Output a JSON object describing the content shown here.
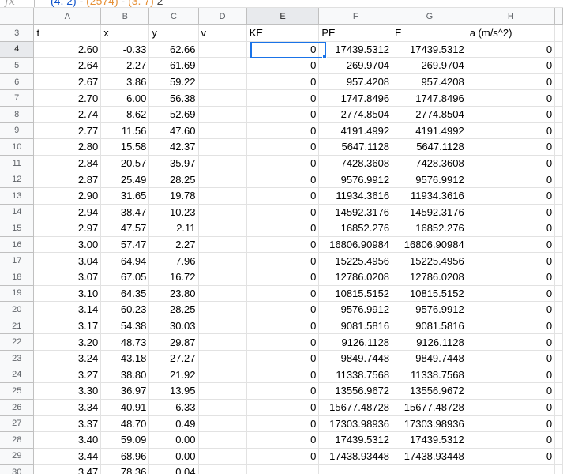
{
  "formula_bar": {
    "fx_label": "fx",
    "formula_part1": "(4. 2)",
    "formula_part2": "(2574)",
    "formula_part3": "(3. 7)",
    "formula_tail": "2"
  },
  "columns": [
    "A",
    "B",
    "C",
    "D",
    "E",
    "F",
    "G",
    "H"
  ],
  "selected_column": "E",
  "selected_row": "4",
  "header_row": {
    "number": "3",
    "cells": [
      "t",
      "x",
      "y",
      "v",
      "KE",
      "PE",
      "E",
      "a (m/s^2)"
    ]
  },
  "rows": [
    {
      "n": "4",
      "c": [
        "2.60",
        "-0.33",
        "62.66",
        "",
        "0",
        "17439.5312",
        "17439.5312",
        "0"
      ]
    },
    {
      "n": "5",
      "c": [
        "2.64",
        "2.27",
        "61.69",
        "",
        "0",
        "269.9704",
        "269.9704",
        "0"
      ]
    },
    {
      "n": "6",
      "c": [
        "2.67",
        "3.86",
        "59.22",
        "",
        "0",
        "957.4208",
        "957.4208",
        "0"
      ]
    },
    {
      "n": "7",
      "c": [
        "2.70",
        "6.00",
        "56.38",
        "",
        "0",
        "1747.8496",
        "1747.8496",
        "0"
      ]
    },
    {
      "n": "8",
      "c": [
        "2.74",
        "8.62",
        "52.69",
        "",
        "0",
        "2774.8504",
        "2774.8504",
        "0"
      ]
    },
    {
      "n": "9",
      "c": [
        "2.77",
        "11.56",
        "47.60",
        "",
        "0",
        "4191.4992",
        "4191.4992",
        "0"
      ]
    },
    {
      "n": "10",
      "c": [
        "2.80",
        "15.58",
        "42.37",
        "",
        "0",
        "5647.1128",
        "5647.1128",
        "0"
      ]
    },
    {
      "n": "11",
      "c": [
        "2.84",
        "20.57",
        "35.97",
        "",
        "0",
        "7428.3608",
        "7428.3608",
        "0"
      ]
    },
    {
      "n": "12",
      "c": [
        "2.87",
        "25.49",
        "28.25",
        "",
        "0",
        "9576.9912",
        "9576.9912",
        "0"
      ]
    },
    {
      "n": "13",
      "c": [
        "2.90",
        "31.65",
        "19.78",
        "",
        "0",
        "11934.3616",
        "11934.3616",
        "0"
      ]
    },
    {
      "n": "14",
      "c": [
        "2.94",
        "38.47",
        "10.23",
        "",
        "0",
        "14592.3176",
        "14592.3176",
        "0"
      ]
    },
    {
      "n": "15",
      "c": [
        "2.97",
        "47.57",
        "2.11",
        "",
        "0",
        "16852.276",
        "16852.276",
        "0"
      ]
    },
    {
      "n": "16",
      "c": [
        "3.00",
        "57.47",
        "2.27",
        "",
        "0",
        "16806.90984",
        "16806.90984",
        "0"
      ]
    },
    {
      "n": "17",
      "c": [
        "3.04",
        "64.94",
        "7.96",
        "",
        "0",
        "15225.4956",
        "15225.4956",
        "0"
      ]
    },
    {
      "n": "18",
      "c": [
        "3.07",
        "67.05",
        "16.72",
        "",
        "0",
        "12786.0208",
        "12786.0208",
        "0"
      ]
    },
    {
      "n": "19",
      "c": [
        "3.10",
        "64.35",
        "23.80",
        "",
        "0",
        "10815.5152",
        "10815.5152",
        "0"
      ]
    },
    {
      "n": "20",
      "c": [
        "3.14",
        "60.23",
        "28.25",
        "",
        "0",
        "9576.9912",
        "9576.9912",
        "0"
      ]
    },
    {
      "n": "21",
      "c": [
        "3.17",
        "54.38",
        "30.03",
        "",
        "0",
        "9081.5816",
        "9081.5816",
        "0"
      ]
    },
    {
      "n": "22",
      "c": [
        "3.20",
        "48.73",
        "29.87",
        "",
        "0",
        "9126.1128",
        "9126.1128",
        "0"
      ]
    },
    {
      "n": "23",
      "c": [
        "3.24",
        "43.18",
        "27.27",
        "",
        "0",
        "9849.7448",
        "9849.7448",
        "0"
      ]
    },
    {
      "n": "24",
      "c": [
        "3.27",
        "38.80",
        "21.92",
        "",
        "0",
        "11338.7568",
        "11338.7568",
        "0"
      ]
    },
    {
      "n": "25",
      "c": [
        "3.30",
        "36.97",
        "13.95",
        "",
        "0",
        "13556.9672",
        "13556.9672",
        "0"
      ]
    },
    {
      "n": "26",
      "c": [
        "3.34",
        "40.91",
        "6.33",
        "",
        "0",
        "15677.48728",
        "15677.48728",
        "0"
      ]
    },
    {
      "n": "27",
      "c": [
        "3.37",
        "48.70",
        "0.49",
        "",
        "0",
        "17303.98936",
        "17303.98936",
        "0"
      ]
    },
    {
      "n": "28",
      "c": [
        "3.40",
        "59.09",
        "0.00",
        "",
        "0",
        "17439.5312",
        "17439.5312",
        "0"
      ]
    },
    {
      "n": "29",
      "c": [
        "3.44",
        "68.96",
        "0.00",
        "",
        "0",
        "17438.93448",
        "17438.93448",
        "0"
      ]
    },
    {
      "n": "30",
      "c": [
        "3.47",
        "78.36",
        "0.04",
        "",
        "",
        "",
        "",
        ""
      ]
    }
  ],
  "colors": {
    "selection": "#1a73e8",
    "header_bg": "#f8f9fa",
    "gridline": "#e2e2e2"
  }
}
